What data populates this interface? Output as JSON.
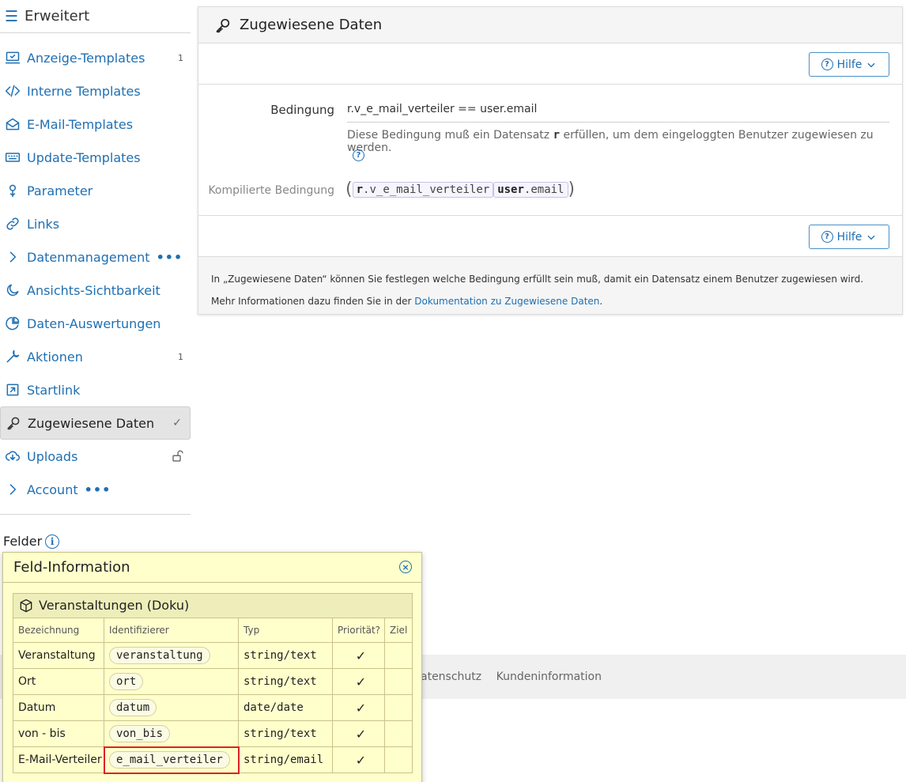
{
  "sidebar": {
    "title": "Erweitert",
    "items": [
      {
        "label": "Anzeige-Templates",
        "badge": "1"
      },
      {
        "label": "Interne Templates"
      },
      {
        "label": "E-Mail-Templates"
      },
      {
        "label": "Update-Templates"
      },
      {
        "label": "Parameter"
      },
      {
        "label": "Links"
      },
      {
        "label": "Datenmanagement",
        "more": "•••"
      },
      {
        "label": "Ansichts-Sichtbarkeit"
      },
      {
        "label": "Daten-Auswertungen"
      },
      {
        "label": "Aktionen",
        "badge": "1"
      },
      {
        "label": "Startlink"
      },
      {
        "label": "Zugewiesene Daten",
        "check": "✓"
      },
      {
        "label": "Uploads"
      },
      {
        "label": "Account",
        "more": "•••"
      }
    ],
    "felder_label": "Felder"
  },
  "panel": {
    "title": "Zugewiesene Daten",
    "help_label": "Hilfe",
    "bedingung_label": "Bedingung",
    "bedingung_value": "r.v_e_mail_verteiler  ==  user.email",
    "desc_before": "Diese Bedingung muß ein Datensatz ",
    "desc_var": "r",
    "desc_after": " erfüllen, um dem eingeloggten Benutzer zugewiesen zu werden.",
    "kompiliert_label": "Kompilierte Bedingung",
    "komp": {
      "left_obj": "r",
      "left_attr": "v_e_mail_verteiler",
      "right_obj": "user",
      "right_attr": "email"
    },
    "footer_line1": "In „Zugewiesene Daten“ können Sie festlegen welche Bedingung erfüllt sein muß, damit ein Datensatz einem Benutzer zugewiesen wird.",
    "footer_line2_before": "Mehr Informationen dazu finden Sie in der ",
    "footer_link": "Dokumentation zu Zugewiesene Daten",
    "footer_line2_after": "."
  },
  "page_footer": {
    "links": [
      "atenschutz",
      "Kundeninformation"
    ]
  },
  "popup": {
    "title": "Feld-Information",
    "model_name": "Veranstaltungen (Doku)",
    "columns": [
      "Bezeichnung",
      "Identifizierer",
      "Typ",
      "Priorität?",
      "Ziel"
    ],
    "rows": [
      {
        "bez": "Veranstaltung",
        "id": "veranstaltung",
        "typ": "string/text",
        "prio": "✓"
      },
      {
        "bez": "Ort",
        "id": "ort",
        "typ": "string/text",
        "prio": "✓"
      },
      {
        "bez": "Datum",
        "id": "datum",
        "typ": "date/date",
        "prio": "✓"
      },
      {
        "bez": "von - bis",
        "id": "von_bis",
        "typ": "string/text",
        "prio": "✓"
      },
      {
        "bez": "E-Mail-Verteiler",
        "id": "e_mail_verteiler",
        "typ": "string/email",
        "prio": "✓"
      }
    ]
  },
  "colors": {
    "accent": "#1f6fb2",
    "popup_bg": "#ffffcc",
    "highlight": "#dd2222"
  }
}
